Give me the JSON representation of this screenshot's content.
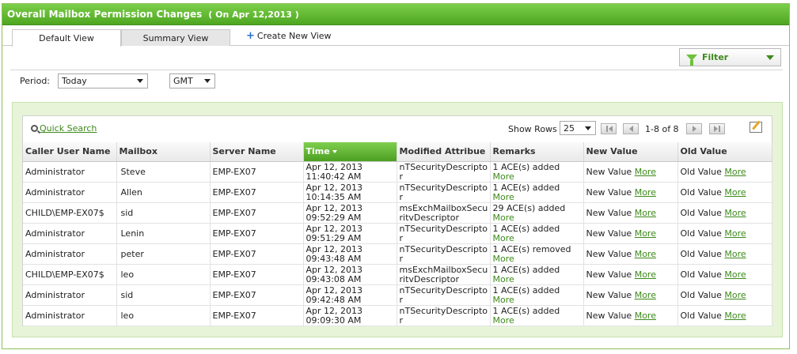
{
  "header": {
    "title": "Overall Mailbox Permission Changes",
    "date_label": "( On Apr 12,2013 )"
  },
  "tabs": [
    {
      "label": "Default View"
    },
    {
      "label": "Summary View"
    }
  ],
  "create_view_label": "Create New View",
  "filter": {
    "label": "Filter"
  },
  "period": {
    "label": "Period:",
    "value": "Today"
  },
  "timezone": {
    "value": "GMT"
  },
  "toolbar": {
    "quick_search": "Quick Search",
    "show_rows_label": "Show Rows",
    "rows_value": "25",
    "page_info": "1-8 of 8"
  },
  "table": {
    "columns": [
      "Caller User Name",
      "Mailbox",
      "Server Name",
      "Time",
      "Modified Attribue",
      "Remarks",
      "New Value",
      "Old Value"
    ],
    "more_label": "More",
    "rows": [
      {
        "caller": "Administrator",
        "mailbox": "Steve",
        "server": "EMP-EX07",
        "date": "Apr 12, 2013",
        "time": "11:40:42 AM",
        "attr1": "nTSecurityDescripto",
        "attr2": "r",
        "remark": "1 ACE(s) added",
        "new_value": "New Value",
        "old_value": "Old Value"
      },
      {
        "caller": "Administrator",
        "mailbox": "Allen",
        "server": "EMP-EX07",
        "date": "Apr 12, 2013",
        "time": "10:14:35 AM",
        "attr1": "nTSecurityDescripto",
        "attr2": "r",
        "remark": "1 ACE(s) added",
        "new_value": "New Value",
        "old_value": "Old Value"
      },
      {
        "caller": "CHILD\\EMP-EX07$",
        "mailbox": "sid",
        "server": "EMP-EX07",
        "date": "Apr 12, 2013",
        "time": "09:52:29 AM",
        "attr1": "msExchMailboxSecu",
        "attr2": "ritvDescriptor",
        "remark": "29 ACE(s) added",
        "new_value": "New Value",
        "old_value": "Old Value"
      },
      {
        "caller": "Administrator",
        "mailbox": "Lenin",
        "server": "EMP-EX07",
        "date": "Apr 12, 2013",
        "time": "09:51:29 AM",
        "attr1": "nTSecurityDescripto",
        "attr2": "r",
        "remark": "1 ACE(s) added",
        "new_value": "New Value",
        "old_value": "Old Value"
      },
      {
        "caller": "Administrator",
        "mailbox": "peter",
        "server": "EMP-EX07",
        "date": "Apr 12, 2013",
        "time": "09:43:48 AM",
        "attr1": "nTSecurityDescripto",
        "attr2": "r",
        "remark": "1 ACE(s) removed",
        "new_value": "New Value",
        "old_value": "Old Value"
      },
      {
        "caller": "CHILD\\EMP-EX07$",
        "mailbox": "leo",
        "server": "EMP-EX07",
        "date": "Apr 12, 2013",
        "time": "09:43:08 AM",
        "attr1": "msExchMailboxSecu",
        "attr2": "ritvDescriptor",
        "remark": "1 ACE(s) added",
        "new_value": "New Value",
        "old_value": "Old Value"
      },
      {
        "caller": "Administrator",
        "mailbox": "sid",
        "server": "EMP-EX07",
        "date": "Apr 12, 2013",
        "time": "09:42:48 AM",
        "attr1": "nTSecurityDescripto",
        "attr2": "r",
        "remark": "1 ACE(s) added",
        "new_value": "New Value",
        "old_value": "Old Value"
      },
      {
        "caller": "Administrator",
        "mailbox": "leo",
        "server": "EMP-EX07",
        "date": "Apr 12, 2013",
        "time": "09:09:30 AM",
        "attr1": "nTSecurityDescripto",
        "attr2": "r",
        "remark": "1 ACE(s) added",
        "new_value": "New Value",
        "old_value": "Old Value"
      }
    ]
  }
}
